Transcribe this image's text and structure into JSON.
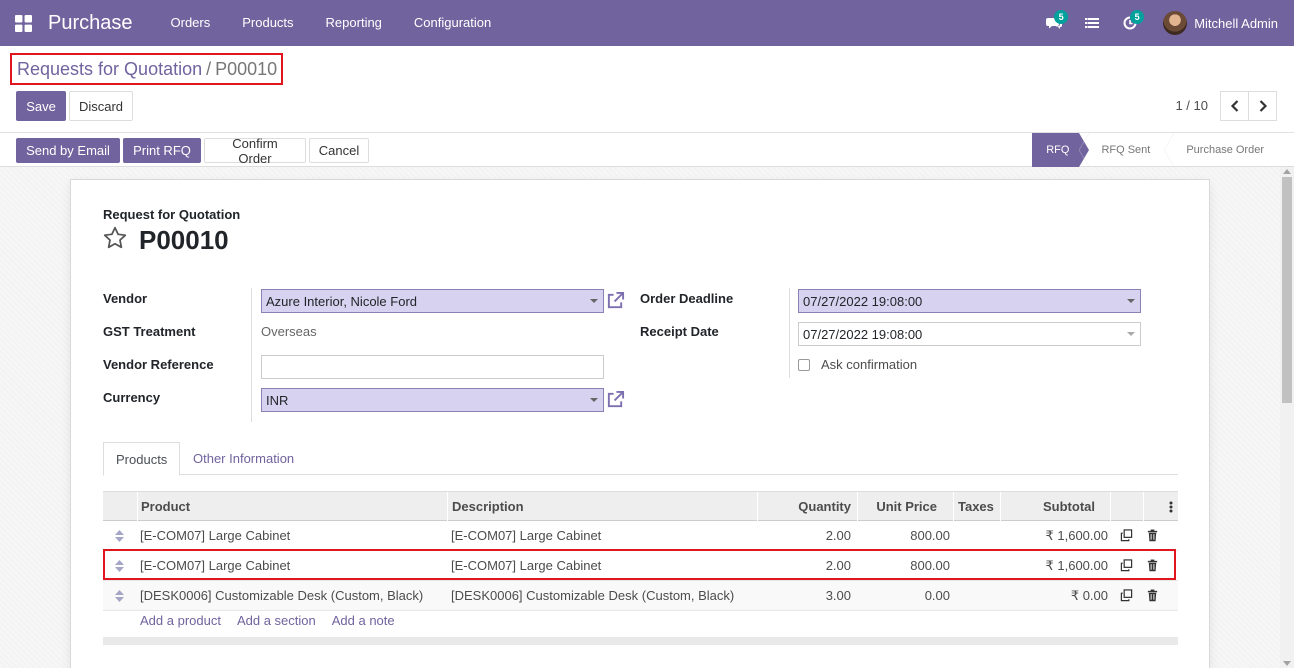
{
  "navbar": {
    "app_name": "Purchase",
    "menu": [
      "Orders",
      "Products",
      "Reporting",
      "Configuration"
    ],
    "messages_count": "5",
    "activities_count": "5",
    "user_name": "Mitchell Admin"
  },
  "breadcrumb": {
    "parent": "Requests for Quotation",
    "separator": "/",
    "current": "P00010"
  },
  "buttons": {
    "save": "Save",
    "discard": "Discard",
    "send_email": "Send by Email",
    "print_rfq": "Print RFQ",
    "confirm_order": "Confirm Order",
    "cancel": "Cancel"
  },
  "pager": {
    "value": "1 / 10"
  },
  "stages": [
    "RFQ",
    "RFQ Sent",
    "Purchase Order"
  ],
  "document": {
    "label": "Request for Quotation",
    "name": "P00010"
  },
  "fields": {
    "vendor_label": "Vendor",
    "vendor_value": "Azure Interior, Nicole Ford",
    "gst_label": "GST Treatment",
    "gst_value": "Overseas",
    "vendor_ref_label": "Vendor Reference",
    "vendor_ref_value": "",
    "currency_label": "Currency",
    "currency_value": "INR",
    "deadline_label": "Order Deadline",
    "deadline_value": "07/27/2022 19:08:00",
    "receipt_label": "Receipt Date",
    "receipt_value": "07/27/2022 19:08:00",
    "ask_confirmation_label": "Ask confirmation"
  },
  "tabs": [
    "Products",
    "Other Information"
  ],
  "table": {
    "headers": {
      "product": "Product",
      "description": "Description",
      "quantity": "Quantity",
      "unit_price": "Unit Price",
      "taxes": "Taxes",
      "subtotal": "Subtotal"
    },
    "rows": [
      {
        "product": "[E-COM07] Large Cabinet",
        "description": "[E-COM07] Large Cabinet",
        "quantity": "2.00",
        "unit_price": "800.00",
        "taxes": "",
        "subtotal": "₹ 1,600.00"
      },
      {
        "product": "[E-COM07] Large Cabinet",
        "description": "[E-COM07] Large Cabinet",
        "quantity": "2.00",
        "unit_price": "800.00",
        "taxes": "",
        "subtotal": "₹ 1,600.00"
      },
      {
        "product": "[DESK0006] Customizable Desk (Custom, Black)",
        "description": "[DESK0006] Customizable Desk (Custom, Black)",
        "quantity": "3.00",
        "unit_price": "0.00",
        "taxes": "",
        "subtotal": "₹ 0.00"
      }
    ],
    "add_product": "Add a product",
    "add_section": "Add a section",
    "add_note": "Add a note"
  },
  "colors": {
    "brand": "#71639e",
    "highlight": "#e0161e",
    "required_field": "#d6d2f0"
  }
}
